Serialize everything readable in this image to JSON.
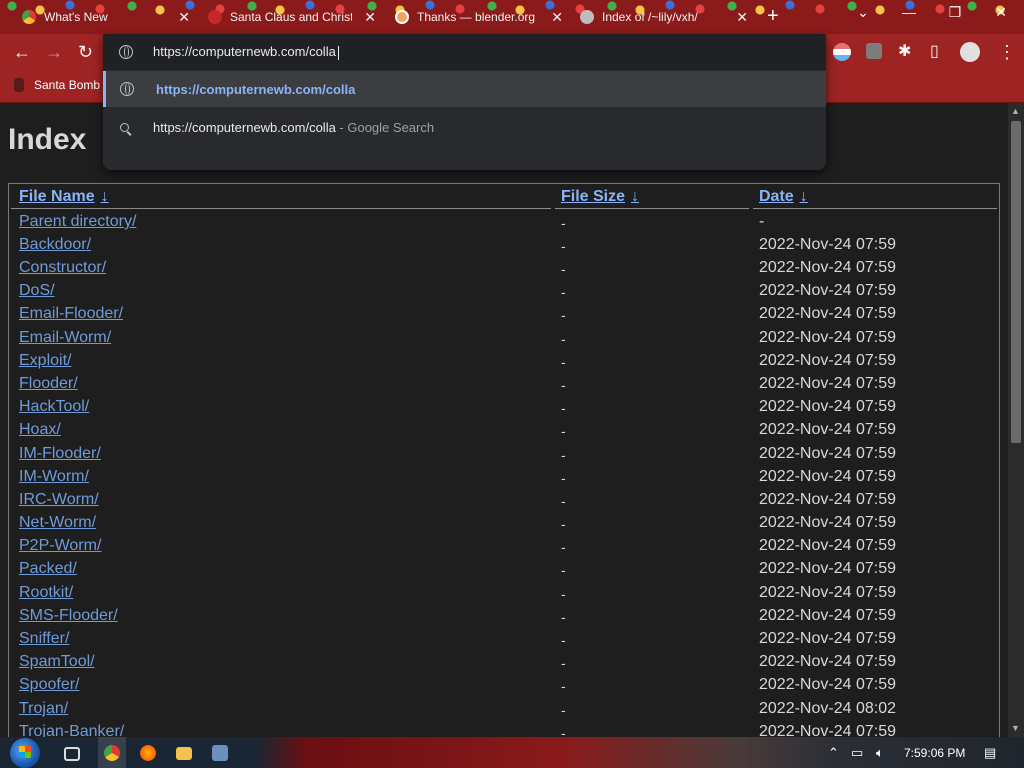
{
  "tabs": [
    {
      "title": "What's New",
      "color": "#d9d9d9"
    },
    {
      "title": "Santa Claus and Christ",
      "color": "#c62828"
    },
    {
      "title": "Thanks — blender.org",
      "color": "#f4a261"
    },
    {
      "title": "Index of /~lily/vxh/",
      "color": "#bdbdbd"
    }
  ],
  "omnibox": {
    "input_value": "https://computernewb.com/colla",
    "suggestions": [
      {
        "text": "https://computernewb.com/colla",
        "suffix": "",
        "icon": "globe-icon"
      },
      {
        "text": "https://computernewb.com/colla",
        "suffix": " - Google Search",
        "icon": "search-icon"
      }
    ]
  },
  "bookmark": {
    "label": "Santa Bomb"
  },
  "page": {
    "title": "Index"
  },
  "listing": {
    "headers": {
      "name": "File Name",
      "size": "File Size",
      "date": "Date",
      "sort_arrow": "↓"
    },
    "rows": [
      {
        "name": "Parent directory/",
        "size": "-",
        "date": "-"
      },
      {
        "name": "Backdoor/",
        "size": "-",
        "date": "2022-Nov-24 07:59"
      },
      {
        "name": "Constructor/",
        "size": "-",
        "date": "2022-Nov-24 07:59"
      },
      {
        "name": "DoS/",
        "size": "-",
        "date": "2022-Nov-24 07:59"
      },
      {
        "name": "Email-Flooder/",
        "size": "-",
        "date": "2022-Nov-24 07:59"
      },
      {
        "name": "Email-Worm/",
        "size": "-",
        "date": "2022-Nov-24 07:59"
      },
      {
        "name": "Exploit/",
        "size": "-",
        "date": "2022-Nov-24 07:59"
      },
      {
        "name": "Flooder/",
        "size": "-",
        "date": "2022-Nov-24 07:59"
      },
      {
        "name": "HackTool/",
        "size": "-",
        "date": "2022-Nov-24 07:59"
      },
      {
        "name": "Hoax/",
        "size": "-",
        "date": "2022-Nov-24 07:59"
      },
      {
        "name": "IM-Flooder/",
        "size": "-",
        "date": "2022-Nov-24 07:59"
      },
      {
        "name": "IM-Worm/",
        "size": "-",
        "date": "2022-Nov-24 07:59"
      },
      {
        "name": "IRC-Worm/",
        "size": "-",
        "date": "2022-Nov-24 07:59"
      },
      {
        "name": "Net-Worm/",
        "size": "-",
        "date": "2022-Nov-24 07:59"
      },
      {
        "name": "P2P-Worm/",
        "size": "-",
        "date": "2022-Nov-24 07:59"
      },
      {
        "name": "Packed/",
        "size": "-",
        "date": "2022-Nov-24 07:59"
      },
      {
        "name": "Rootkit/",
        "size": "-",
        "date": "2022-Nov-24 07:59"
      },
      {
        "name": "SMS-Flooder/",
        "size": "-",
        "date": "2022-Nov-24 07:59"
      },
      {
        "name": "Sniffer/",
        "size": "-",
        "date": "2022-Nov-24 07:59"
      },
      {
        "name": "SpamTool/",
        "size": "-",
        "date": "2022-Nov-24 07:59"
      },
      {
        "name": "Spoofer/",
        "size": "-",
        "date": "2022-Nov-24 07:59"
      },
      {
        "name": "Trojan/",
        "size": "-",
        "date": "2022-Nov-24 08:02"
      },
      {
        "name": "Trojan-Banker/",
        "size": "-",
        "date": "2022-Nov-24 07:59"
      }
    ]
  },
  "taskbar": {
    "clock": "7:59:06 PM"
  },
  "colors": {
    "link": "#6f9bd9",
    "toolbar": "#9e2424",
    "omnibox": "#292a2d"
  }
}
